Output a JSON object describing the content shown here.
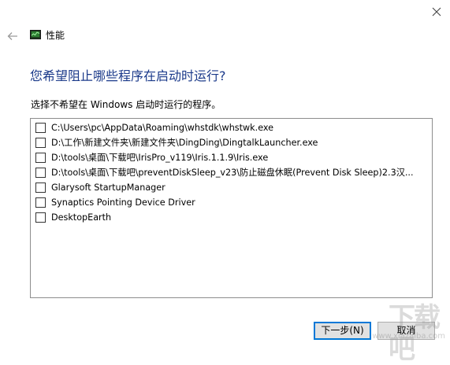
{
  "window": {
    "close_icon": "close-icon"
  },
  "header": {
    "back_icon": "back-arrow-icon",
    "icon": "performance-icon",
    "title": "性能"
  },
  "main": {
    "heading": "您希望阻止哪些程序在启动时运行?",
    "instruction": "选择不希望在 Windows 启动时运行的程序。"
  },
  "programs": [
    {
      "label": "C:\\Users\\pc\\AppData\\Roaming\\whstdk\\whstwk.exe",
      "checked": false
    },
    {
      "label": "D:\\工作\\新建文件夹\\新建文件夹\\DingDing\\DingtalkLauncher.exe",
      "checked": false
    },
    {
      "label": "D:\\tools\\桌面\\下载吧\\IrisPro_v119\\Iris.1.1.9\\Iris.exe",
      "checked": false
    },
    {
      "label": "D:\\tools\\桌面\\下载吧\\preventDiskSleep_v23\\防止磁盘休眠(Prevent Disk Sleep)2.3汉...",
      "checked": false
    },
    {
      "label": "Glarysoft StartupManager",
      "checked": false
    },
    {
      "label": "Synaptics Pointing Device Driver",
      "checked": false
    },
    {
      "label": "DesktopEarth",
      "checked": false
    }
  ],
  "buttons": {
    "next": "下一步(N)",
    "cancel": "取消"
  },
  "watermark": {
    "main": "下载吧",
    "sub": "www.xiazaiba.com"
  },
  "colors": {
    "heading": "#1b3a8a",
    "primary_border": "#0078d7",
    "button_bg": "#e1e1e1"
  }
}
